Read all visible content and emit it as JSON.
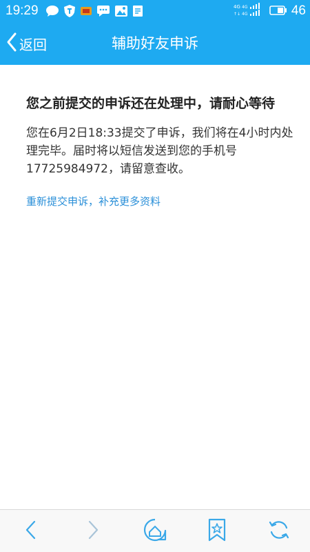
{
  "status_bar": {
    "time": "19:29",
    "battery_level": "46",
    "network_label": "4G",
    "icons": [
      "chat-bubble-icon",
      "shield-icon",
      "notification-badge-icon",
      "sms-icon",
      "gallery-icon",
      "document-icon",
      "signal-icon",
      "battery-icon"
    ]
  },
  "header": {
    "back_label": "返回",
    "title": "辅助好友申诉"
  },
  "main": {
    "heading": "您之前提交的申诉还在处理中，请耐心等待",
    "body": "您在6月2日18:33提交了申诉，我们将在4小时内处理完毕。届时将以短信发送到您的手机号17725984972，请留意查收。",
    "resubmit_link": "重新提交申诉，补充更多资料"
  },
  "bottom_nav": {
    "items": [
      "back-arrow-icon",
      "forward-arrow-icon",
      "home-icon",
      "bookmark-icon",
      "refresh-icon"
    ]
  },
  "colors": {
    "header_blue": "#1eaaf1",
    "link_blue": "#2a8fd8",
    "nav_icon": "#3aa8e8",
    "nav_icon_disabled": "#a9c4d8"
  }
}
